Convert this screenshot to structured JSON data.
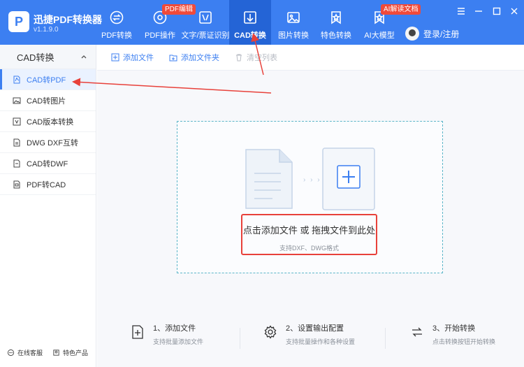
{
  "app": {
    "title": "迅捷PDF转换器",
    "version": "v1.1.9.0",
    "logo_letter": "P"
  },
  "nav": [
    {
      "label": "PDF转换",
      "icon": "convert-icon"
    },
    {
      "label": "PDF操作",
      "icon": "target-icon",
      "badge": "PDF编辑"
    },
    {
      "label": "文字/票证识别",
      "icon": "scan-icon"
    },
    {
      "label": "CAD转换",
      "icon": "cad-icon",
      "active": true
    },
    {
      "label": "图片转换",
      "icon": "image-icon"
    },
    {
      "label": "特色转换",
      "icon": "star-icon"
    },
    {
      "label": "AI大模型",
      "icon": "ai-icon",
      "badge": "AI解读文档"
    }
  ],
  "login": {
    "label": "登录/注册"
  },
  "sidebar": {
    "header": "CAD转换",
    "items": [
      {
        "label": "CAD转PDF",
        "icon": "pdf-file-icon",
        "active": true
      },
      {
        "label": "CAD转图片",
        "icon": "image-file-icon"
      },
      {
        "label": "CAD版本转换",
        "icon": "version-icon"
      },
      {
        "label": "DWG DXF互转",
        "icon": "dwg-file-icon"
      },
      {
        "label": "CAD转DWF",
        "icon": "dwf-file-icon"
      },
      {
        "label": "PDF转CAD",
        "icon": "cad-file-icon"
      }
    ],
    "footer": {
      "service": "在线客服",
      "featured": "特色产品"
    }
  },
  "toolbar": {
    "add_file": "添加文件",
    "add_folder": "添加文件夹",
    "clear_list": "清空列表"
  },
  "dropzone": {
    "main_text": "点击添加文件 或 拖拽文件到此处",
    "sub_text": "支持DXF、DWG格式",
    "arrows": "› › ›"
  },
  "steps": [
    {
      "title": "1、添加文件",
      "desc": "支持批量添加文件",
      "icon": "add-file-icon"
    },
    {
      "title": "2、设置输出配置",
      "desc": "支持批量操作和各种设置",
      "icon": "settings-icon"
    },
    {
      "title": "3、开始转换",
      "desc": "点击转换按钮开始转换",
      "icon": "convert-start-icon"
    }
  ],
  "colors": {
    "brand": "#3c7ff1",
    "active_tab": "#2464d6",
    "badge": "#f04a3a",
    "highlight": "#e8413a"
  }
}
